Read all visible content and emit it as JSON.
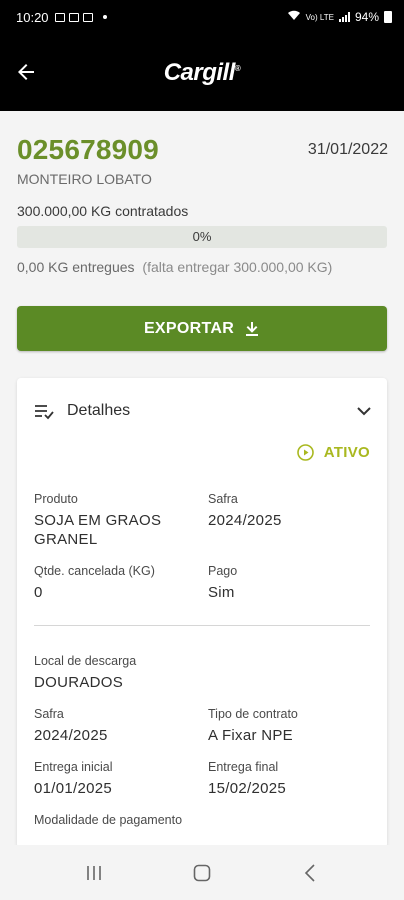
{
  "status_bar": {
    "time": "10:20",
    "network": "Vo) LTE",
    "battery": "94%"
  },
  "app_bar": {
    "logo_text": "Cargill",
    "back_icon": "arrow-left-icon"
  },
  "contract": {
    "number": "025678909",
    "date": "31/01/2022",
    "client": "MONTEIRO LOBATO",
    "contracted": "300.000,00 KG contratados",
    "progress_label": "0%",
    "progress_fraction": 0,
    "delivered": "0,00 KG entregues",
    "remaining": "(falta entregar 300.000,00 KG)"
  },
  "export_button": {
    "label": "EXPORTAR",
    "icon": "download-icon"
  },
  "details": {
    "title": "Detalhes",
    "status": "ATIVO",
    "fields_top": [
      {
        "label": "Produto",
        "value": "SOJA EM GRAOS\nGRANEL"
      },
      {
        "label": "Safra",
        "value": "2024/2025"
      },
      {
        "label": "Qtde. cancelada (KG)",
        "value": "0"
      },
      {
        "label": "Pago",
        "value": "Sim"
      }
    ],
    "fields_bottom": [
      {
        "label": "Local de descarga",
        "value": "DOURADOS"
      },
      {
        "label": "Safra",
        "value": "2024/2025"
      },
      {
        "label": "Tipo de contrato",
        "value": "A Fixar NPE"
      },
      {
        "label": "Entrega inicial",
        "value": "01/01/2025"
      },
      {
        "label": "Entrega final",
        "value": "15/02/2025"
      },
      {
        "label": "Modalidade de pagamento",
        "value": ""
      }
    ]
  },
  "colors": {
    "brand_green": "#6b8f2a",
    "button_green": "#5b8a25",
    "status_green": "#a9b81f"
  }
}
